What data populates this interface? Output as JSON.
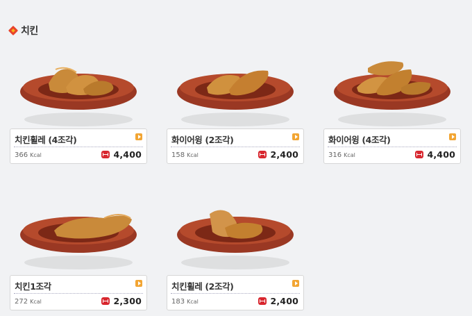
{
  "section": {
    "title": "치킨"
  },
  "products": [
    {
      "name": "치킨휠레 (4조각)",
      "kcal": "366",
      "kcal_unit": "Kcal",
      "price": "4,400",
      "pieces": 4
    },
    {
      "name": "화이어윙 (2조각)",
      "kcal": "158",
      "kcal_unit": "Kcal",
      "price": "2,400",
      "pieces": 2
    },
    {
      "name": "화이어윙 (4조각)",
      "kcal": "316",
      "kcal_unit": "Kcal",
      "price": "4,400",
      "pieces": 4
    },
    {
      "name": "치킨1조각",
      "kcal": "272",
      "kcal_unit": "Kcal",
      "price": "2,300",
      "pieces": 1
    },
    {
      "name": "치킨휠레 (2조각)",
      "kcal": "183",
      "kcal_unit": "Kcal",
      "price": "2,400",
      "pieces": 2
    }
  ],
  "colors": {
    "plate": "#8a2e1e",
    "plate_rim": "#a8442c",
    "chicken": "#c8802f",
    "won_icon": "#d8272f",
    "arrow": "#f2a533"
  }
}
